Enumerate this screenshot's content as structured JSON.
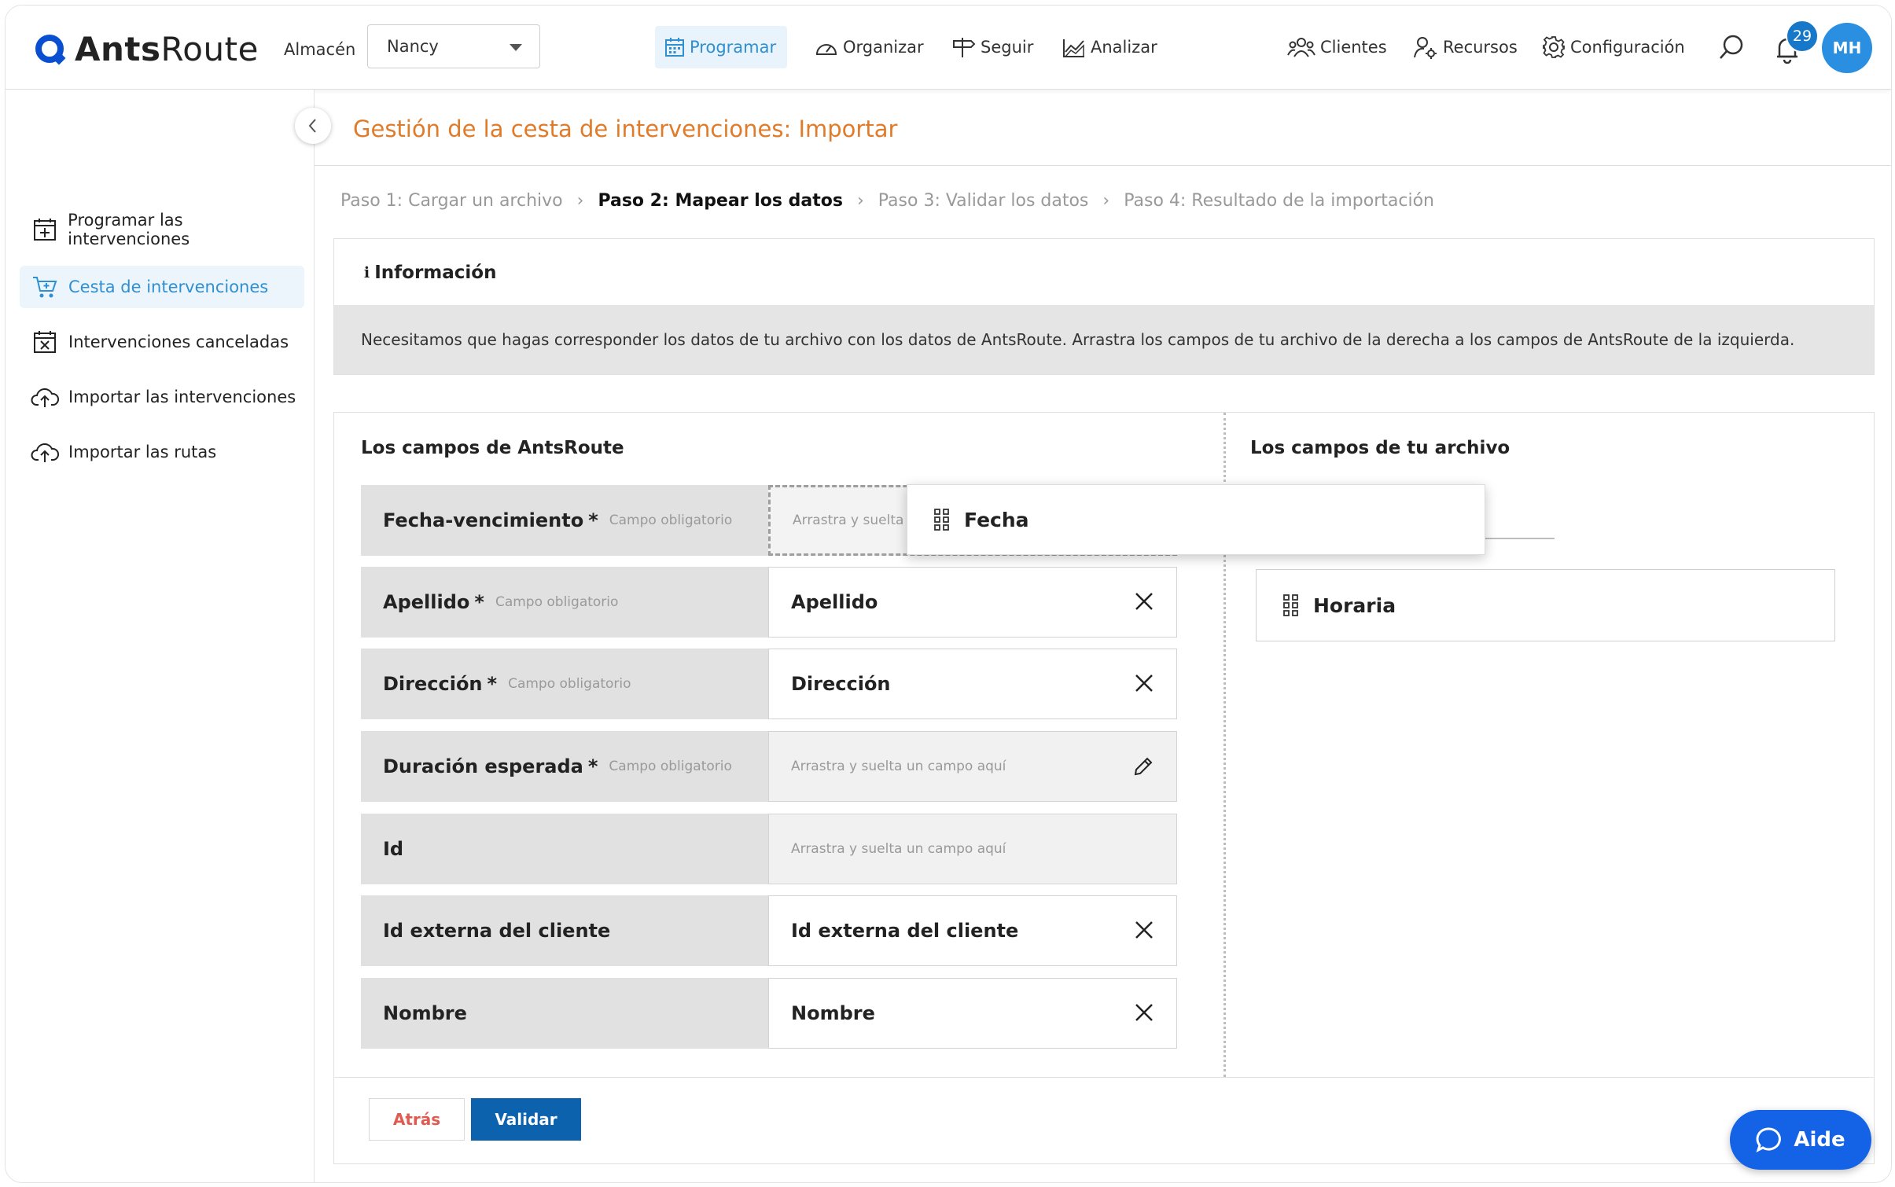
{
  "app": {
    "logo_bold": "Ants",
    "logo_rest": "Route"
  },
  "header": {
    "warehouse_label": "Almacén",
    "warehouse_value": "Nancy",
    "nav": [
      {
        "label": "Programar",
        "icon": "calendar-icon",
        "active": true
      },
      {
        "label": "Organizar",
        "icon": "gauge-icon"
      },
      {
        "label": "Seguir",
        "icon": "signpost-icon"
      },
      {
        "label": "Analizar",
        "icon": "chart-icon"
      },
      {
        "label": "Clientes",
        "icon": "people-icon"
      },
      {
        "label": "Recursos",
        "icon": "resource-user-icon"
      },
      {
        "label": "Configuración",
        "icon": "gear-icon"
      }
    ],
    "notifications_count": "29",
    "avatar_initials": "MH"
  },
  "sidebar": {
    "items": [
      {
        "label": "Programar las intervenciones",
        "icon": "calendar-plus-icon"
      },
      {
        "label": "Cesta de intervenciones",
        "icon": "cart-icon",
        "active": true
      },
      {
        "label": "Intervenciones canceladas",
        "icon": "calendar-x-icon"
      },
      {
        "label": "Importar las intervenciones",
        "icon": "cloud-upload-icon"
      },
      {
        "label": "Importar las rutas",
        "icon": "cloud-upload-icon"
      }
    ]
  },
  "page": {
    "title": "Gestión de la cesta de intervenciones: Importar",
    "steps": [
      "Paso 1: Cargar un archivo",
      "Paso 2: Mapear los datos",
      "Paso 3: Validar los datos",
      "Paso 4: Resultado de la importación"
    ],
    "info_title": "Información",
    "info_text": "Necesitamos que hagas corresponder los datos de tu archivo con los datos de AntsRoute. Arrastra los campos de tu archivo de la derecha a los campos de AntsRoute de la izquierda."
  },
  "mapping": {
    "left_title": "Los campos de AntsRoute",
    "right_title": "Los campos de tu archivo",
    "required_mark": "*",
    "required_hint": "Campo obligatorio",
    "drop_placeholder": "Arrastra y suelta un campo aquí",
    "drop_placeholder_partial": "Arrastra y suelta",
    "rows": [
      {
        "label": "Fecha-vencimiento",
        "required": true,
        "value": ""
      },
      {
        "label": "Apellido",
        "required": true,
        "value": "Apellido"
      },
      {
        "label": "Dirección",
        "required": true,
        "value": "Dirección"
      },
      {
        "label": "Duración esperada",
        "required": true,
        "value": ""
      },
      {
        "label": "Id",
        "required": false,
        "value": ""
      },
      {
        "label": "Id externa del cliente",
        "required": false,
        "value": "Id externa del cliente"
      },
      {
        "label": "Nombre",
        "required": false,
        "value": "Nombre"
      }
    ],
    "dragging_field": "Fecha",
    "file_fields": [
      "Horaria"
    ]
  },
  "actions": {
    "back": "Atrás",
    "validate": "Validar"
  },
  "help": {
    "label": "Aide"
  },
  "colors": {
    "accent": "#2f8fd0",
    "title": "#e07b2a",
    "primary_button": "#0d62ad",
    "help_button": "#1463e6"
  }
}
